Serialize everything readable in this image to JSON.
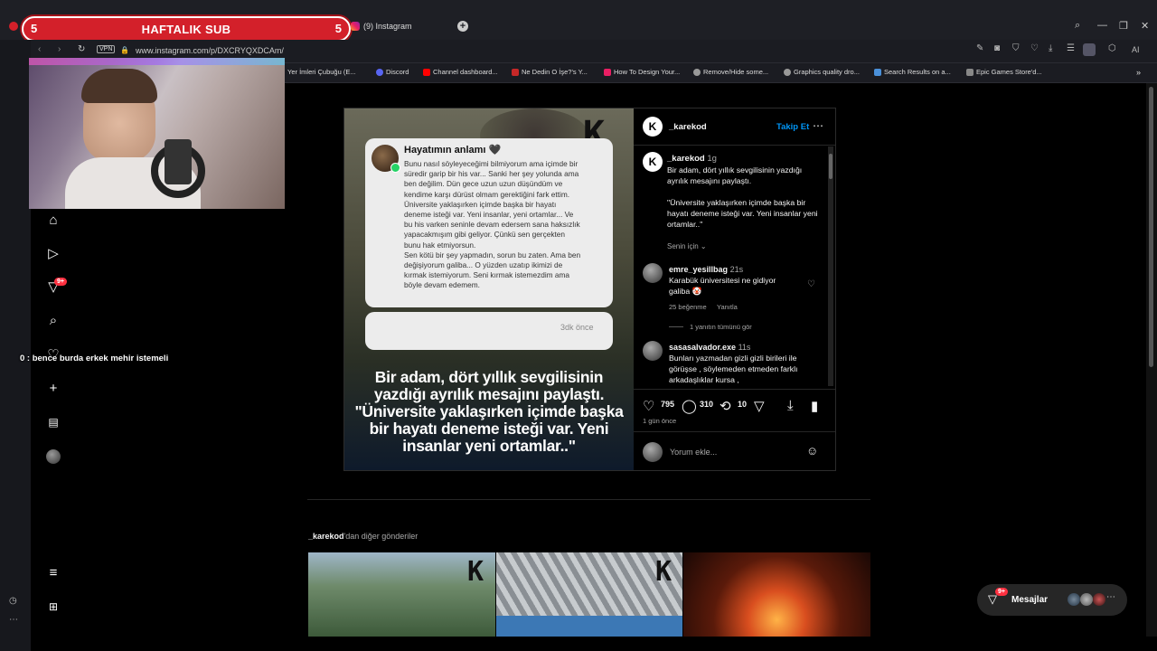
{
  "overlay": {
    "sub_left": "5",
    "sub_title": "HAFTALIK SUB",
    "sub_right": "5",
    "chat_line": "0 : bence burda erkek mehir istemeli"
  },
  "browser": {
    "tab_title": "(9) Instagram",
    "url": "www.instagram.com/p/DXCRYQXDCAm/",
    "vpn": "VPN",
    "ai_label": "AI",
    "bookmarks": [
      "Yer İmleri Çubuğu (E...",
      "Discord",
      "Channel dashboard...",
      "Ne Dedin O İşe?'s Y...",
      "How To Design Your...",
      "Remove/Hide some...",
      "Graphics quality dro...",
      "Search Results on a...",
      "Epic Games Store'd..."
    ]
  },
  "nav": {
    "notif_badge": "9+"
  },
  "post": {
    "author": "_karekod",
    "follow_label": "Takip Et",
    "note_title": "Hayatımın anlamı 🖤",
    "note_body": "Bunu nasıl söyleyeceğimi bilmiyorum ama içimde bir\nsüredir garip bir his var... Sanki her şey yolunda ama\nben değilim. Dün gece uzun uzun düşündüm ve\nkendime karşı dürüst olmam gerektiğini fark ettim.\nÜniversite yaklaşırken içimde başka bir hayatı\ndeneme isteği var. Yeni insanlar, yeni ortamlar... Ve\nbu his varken seninle devam edersem sana haksızlık\nyapacakmışım gibi geliyor. Çünkü sen gerçekten\nbunu hak etmiyorsun.\nSen kötü bir şey yapmadın, sorun bu zaten. Ama ben\ndeğişiyorum galiba... O yüzden uzatıp ikimizi de\nkırmak istemiyorum. Seni kırmak istemezdim ama\nböyle devam edemem.",
    "note_time": "3dk önce",
    "image_caption": "Bir adam, dört yıllık sevgilisinin yazdığı ayrılık mesajını paylaştı. \"Üniversite yaklaşırken içimde başka bir hayatı deneme isteği var. Yeni insanlar yeni ortamlar..\"",
    "caption_author": "_karekod",
    "caption_age": "1g",
    "caption_text": "Bir adam, dört yıllık sevgilisinin yazdığı ayrılık mesajını paylaştı.",
    "caption_quote": "\"Üniversite yaklaşırken içimde başka bir hayatı deneme isteği var. Yeni insanlar yeni ortamlar..\"",
    "for_you": "Senin için",
    "comments": [
      {
        "user": "emre_yesillbag",
        "age": "21s",
        "text": "Karabük üniversitesi ne gidiyor galiba 🤡",
        "likes": "25 beğenme",
        "reply": "Yanıtla",
        "view_replies": "1 yanıtın tümünü gör"
      },
      {
        "user": "sasasalvador.exe",
        "age": "11s",
        "text": "Bunları yazmadan gizli gizli birileri ile görüşse , söylemeden etmeden farklı arkadaşlıklar kursa ,"
      }
    ],
    "likes": "795",
    "comments_count": "310",
    "reposts": "10",
    "posted": "1 gün önce",
    "add_comment_placeholder": "Yorum ekle..."
  },
  "more": {
    "author": "_karekod",
    "suffix": "'dan diğer gönderiler"
  },
  "messages": {
    "label": "Mesajlar",
    "badge": "9+"
  }
}
